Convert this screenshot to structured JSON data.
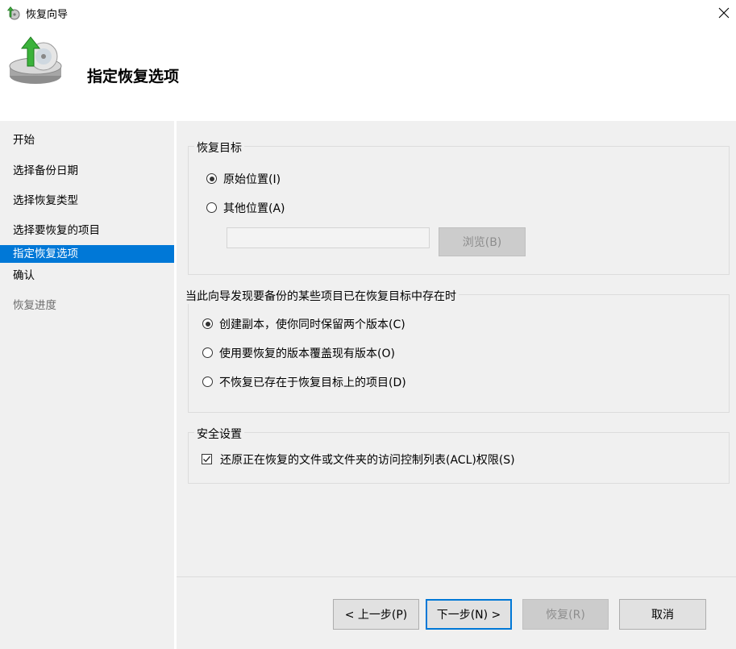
{
  "window": {
    "title": "恢复向导"
  },
  "header": {
    "title": "指定恢复选项"
  },
  "nav": {
    "items": [
      {
        "label": "开始"
      },
      {
        "label": "选择备份日期"
      },
      {
        "label": "选择恢复类型"
      },
      {
        "label": "选择要恢复的项目"
      },
      {
        "label": "指定恢复选项"
      },
      {
        "label": "确认"
      },
      {
        "label": "恢复进度"
      }
    ],
    "selected_index": 4
  },
  "recovery_target": {
    "title": "恢复目标",
    "original_label": "原始位置(I)",
    "other_label": "其他位置(A)",
    "path_value": "",
    "browse_label": "浏览(B)",
    "selected": "original"
  },
  "conflict": {
    "title": "当此向导发现要备份的某些项目已在恢复目标中存在时",
    "options": [
      {
        "label": "创建副本，使你同时保留两个版本(C)"
      },
      {
        "label": "使用要恢复的版本覆盖现有版本(O)"
      },
      {
        "label": "不恢复已存在于恢复目标上的项目(D)"
      }
    ],
    "selected_index": 0
  },
  "security": {
    "title": "安全设置",
    "acl_label": "还原正在恢复的文件或文件夹的访问控制列表(ACL)权限(S)",
    "acl_checked": true
  },
  "footer": {
    "back_label": "< 上一步(P)",
    "next_label": "下一步(N) >",
    "recover_label": "恢复(R)",
    "cancel_label": "取消"
  },
  "colors": {
    "accent": "#0078d7",
    "panel_bg": "#f0f0f0"
  },
  "icons": {
    "app": "backup-restore-icon",
    "header": "backup-disk-arrow-icon",
    "close": "close-icon"
  }
}
